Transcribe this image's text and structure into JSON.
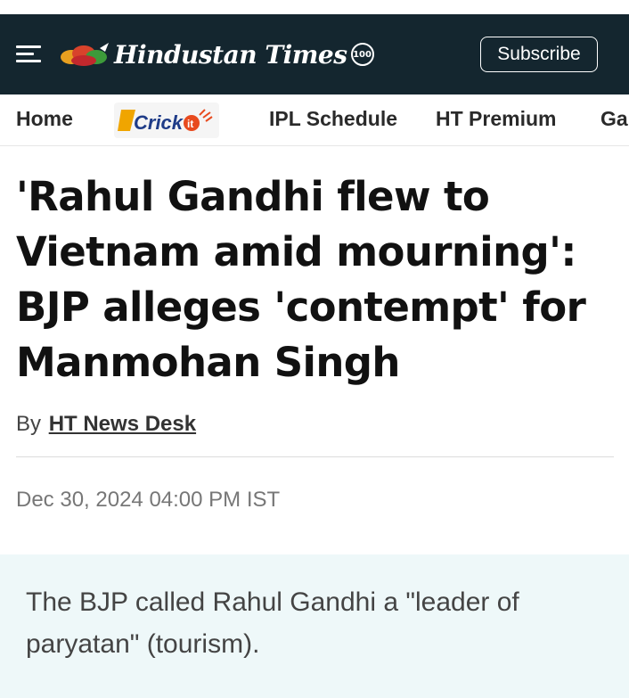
{
  "header": {
    "menu_icon": "hamburger-menu-icon",
    "logo_text": "Hindustan Times",
    "logo_badge": "100",
    "subscribe_label": "Subscribe",
    "background_color": "#14262f"
  },
  "nav": {
    "items": [
      {
        "label": "Home"
      },
      {
        "label": "Crick"
      },
      {
        "label": "IPL Schedule"
      },
      {
        "label": "HT Premium"
      },
      {
        "label": "Ga"
      }
    ]
  },
  "article": {
    "headline": "'Rahul Gandhi flew to Vietnam amid mourning': BJP alleges 'contempt' for Manmohan Singh",
    "by_prefix": "By",
    "author": "HT News Desk",
    "date": "Dec 30, 2024 04:00 PM IST",
    "summary": "The BJP called Rahul Gandhi a \"leader of paryatan\" (tourism)."
  }
}
